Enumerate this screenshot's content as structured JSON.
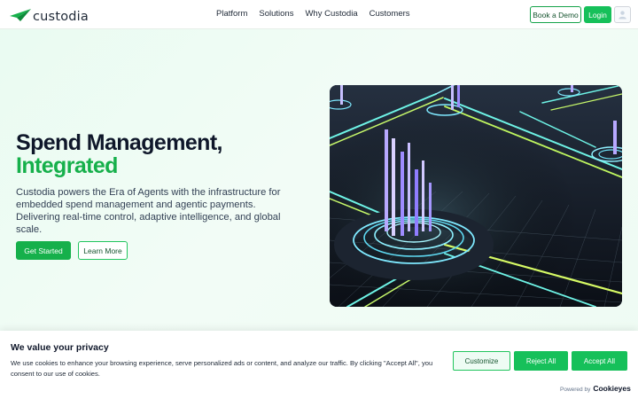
{
  "header": {
    "logo_text": "custodia",
    "nav": [
      "Platform",
      "Solutions",
      "Why Custodia",
      "Customers"
    ],
    "book_demo": "Book a Demo",
    "login": "Login"
  },
  "hero": {
    "headline_line1": "Spend Management,",
    "headline_line2": "Integrated",
    "description": "Custodia powers the Era of Agents with the infrastructure for embedded spend management and agentic payments. Delivering real-time control, adaptive intelligence, and global scale.",
    "primary_cta": "Get Started",
    "secondary_cta": "Learn More"
  },
  "cookie_banner": {
    "title": "We value your privacy",
    "text": "We use cookies to enhance your browsing experience, serve personalized ads or content, and analyze our traffic. By clicking \"Accept All\", you consent to our use of cookies.",
    "customize": "Customize",
    "reject": "Reject All",
    "accept": "Accept All",
    "powered_by": "Powered by",
    "powered_brand": "Cookieyes"
  },
  "colors": {
    "brand_green": "#16b04b",
    "button_green": "#16c05a",
    "headline_dark": "#0f172a"
  },
  "icons": {
    "logo": "paper-plane-logo-icon",
    "user": "user-avatar-icon"
  }
}
